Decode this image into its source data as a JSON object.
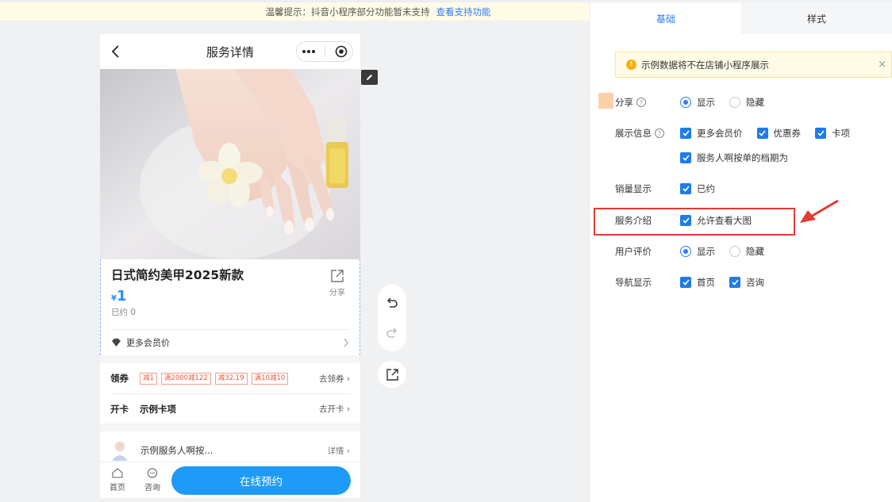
{
  "notice": {
    "text": "温馨提示：抖音小程序部分功能暂未支持",
    "link": "查看支持功能"
  },
  "phone": {
    "nav_title": "服务详情",
    "product": {
      "title": "日式简约美甲2025新款",
      "currency": "¥",
      "price": "1",
      "sold": "已约 0",
      "share_label": "分享"
    },
    "member_price": "更多会员价",
    "coupon": {
      "label": "领券",
      "chips": [
        "减1",
        "满2000减122",
        "减32.19",
        "满10减10"
      ],
      "action": "去领券"
    },
    "card": {
      "label": "开卡",
      "name": "示例卡项",
      "action": "去开卡"
    },
    "staff": {
      "name": "示例服务人啊按...",
      "action": "详情"
    },
    "bottom": {
      "home": "首页",
      "consult": "咨询",
      "book": "在线预约"
    }
  },
  "panel": {
    "tabs": [
      {
        "label": "基础",
        "active": true
      },
      {
        "label": "样式",
        "active": false
      }
    ],
    "alert": "示例数据将不在店铺小程序展示",
    "rows": {
      "share": {
        "label": "分享",
        "options": [
          "显示",
          "隐藏"
        ],
        "selected": "显示"
      },
      "display_info": {
        "label": "展示信息",
        "checks": [
          "更多会员价",
          "优惠券",
          "卡项"
        ],
        "checks2": [
          "服务人啊按单的档期为"
        ]
      },
      "sales": {
        "label": "销量显示",
        "checks": [
          "已约"
        ]
      },
      "intro": {
        "label": "服务介绍",
        "checks": [
          "允许查看大图"
        ]
      },
      "review": {
        "label": "用户评价",
        "options": [
          "显示",
          "隐藏"
        ],
        "selected": "显示"
      },
      "nav": {
        "label": "导航显示",
        "checks": [
          "首页",
          "咨询"
        ]
      }
    }
  },
  "colors": {
    "accent": "#2b7cf6",
    "book_button": "#1e9bf7",
    "highlight": "#e23b30",
    "coupon": "#e9573a"
  }
}
